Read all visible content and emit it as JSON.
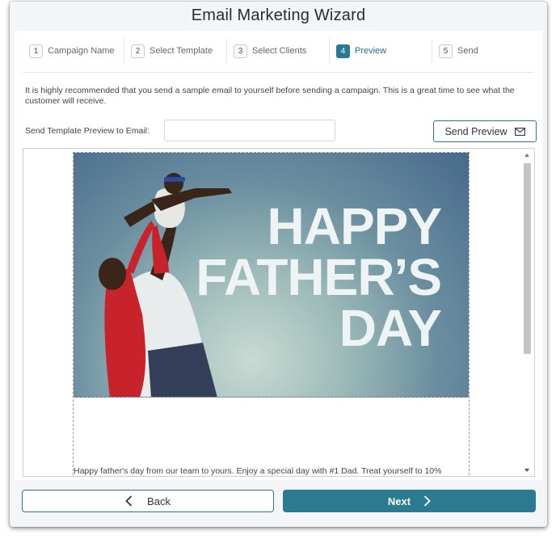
{
  "wizard": {
    "title": "Email Marketing Wizard"
  },
  "steps": [
    {
      "number": "1",
      "label": "Campaign Name",
      "active": false
    },
    {
      "number": "2",
      "label": "Select Template",
      "active": false
    },
    {
      "number": "3",
      "label": "Select Clients",
      "active": false
    },
    {
      "number": "4",
      "label": "Preview",
      "active": true
    },
    {
      "number": "5",
      "label": "Send",
      "active": false
    }
  ],
  "preview": {
    "instructions": "It is highly recommended that you send a sample email to yourself before sending a campaign. This is a great time to see what the customer will receive.",
    "email_label": "Send Template Preview to Email:",
    "email_value": "",
    "email_placeholder": "",
    "send_button_label": "Send Preview",
    "send_button_icon": "envelope-icon"
  },
  "email_template": {
    "hero_lines": [
      "HAPPY",
      "FATHER’S",
      "DAY"
    ],
    "body_text": "Happy father's day from our team to yours. Enjoy a special day with #1 Dad. Treat yourself to 10%"
  },
  "footer": {
    "back_label": "Back",
    "next_label": "Next",
    "back_icon": "chevron-left-icon",
    "next_icon": "chevron-right-icon"
  },
  "colors": {
    "accent": "#2b7a92",
    "active_step": "#2a7896",
    "background": "#f4f5f7"
  }
}
